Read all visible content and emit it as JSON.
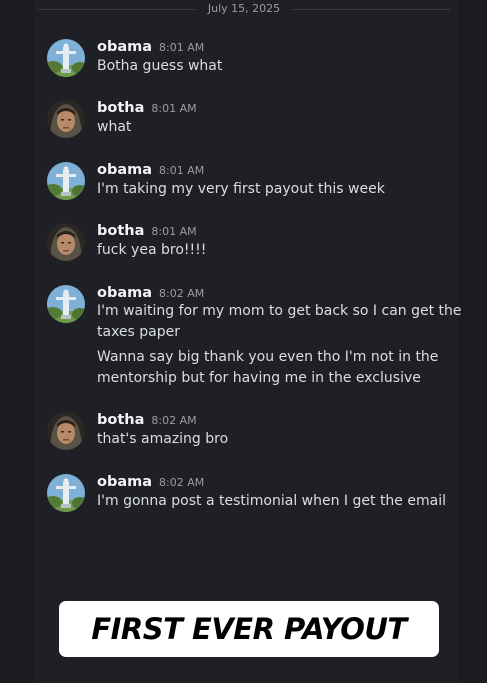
{
  "date_divider": "July 15, 2025",
  "users": {
    "obama": {
      "name": "obama",
      "avatar_icon": "statue-avatar-icon"
    },
    "botha": {
      "name": "botha",
      "avatar_icon": "hooded-person-avatar-icon"
    }
  },
  "messages": [
    {
      "author": "obama",
      "time": "8:01 AM",
      "lines": [
        "Botha guess what"
      ]
    },
    {
      "author": "botha",
      "time": "8:01 AM",
      "lines": [
        "what"
      ]
    },
    {
      "author": "obama",
      "time": "8:01 AM",
      "lines": [
        "I'm taking my very first payout this week"
      ]
    },
    {
      "author": "botha",
      "time": "8:01 AM",
      "lines": [
        "fuck yea bro!!!!"
      ]
    },
    {
      "author": "obama",
      "time": "8:02 AM",
      "lines": [
        "I'm waiting for my mom to get back so I can get the",
        "taxes paper",
        "Wanna say big thank you even tho I'm not in the",
        "mentorship but for having me in the exclusive"
      ]
    },
    {
      "author": "botha",
      "time": "8:02 AM",
      "lines": [
        "that's amazing bro"
      ]
    },
    {
      "author": "obama",
      "time": "8:02 AM",
      "lines": [
        "I'm gonna post a testimonial when I get the email"
      ]
    }
  ],
  "banner": {
    "text": "FIRST EVER PAYOUT"
  },
  "colors": {
    "background": "#1b1c21",
    "panel": "#1f2025",
    "username": "#f2f3f5",
    "message_text": "#dbdee1",
    "timestamp": "#9a9ca3",
    "banner_bg": "#ffffff",
    "banner_text": "#000000"
  }
}
